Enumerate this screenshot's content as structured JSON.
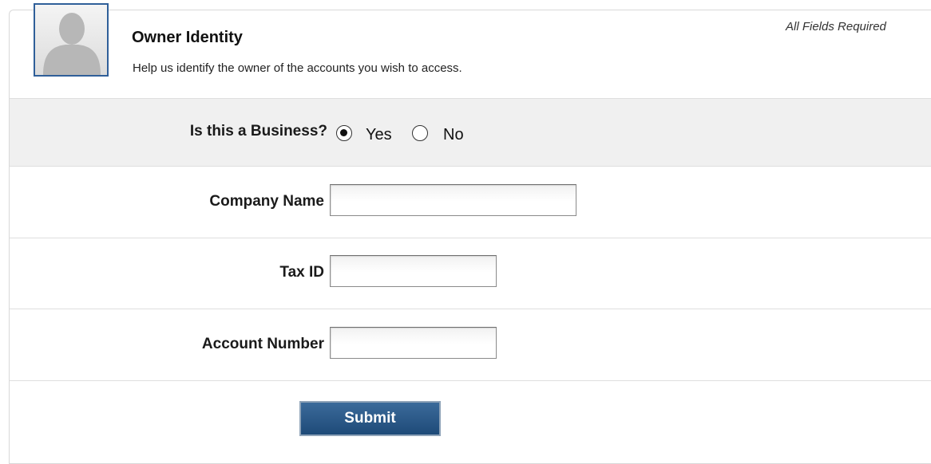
{
  "header": {
    "title": "Owner Identity",
    "subtitle": "Help us identify the owner of the accounts you wish to access.",
    "required_note": "All Fields Required",
    "avatar_icon": "person-silhouette-icon"
  },
  "form": {
    "business_question": {
      "label": "Is this a Business?",
      "options": [
        {
          "label": "Yes",
          "selected": true
        },
        {
          "label": "No",
          "selected": false
        }
      ]
    },
    "company_name": {
      "label": "Company Name",
      "value": ""
    },
    "tax_id": {
      "label": "Tax ID",
      "value": ""
    },
    "account_number": {
      "label": "Account Number",
      "value": ""
    },
    "submit_label": "Submit"
  },
  "colors": {
    "accent": "#2f5f99",
    "button": "#1e4a78",
    "shaded_row": "#f0f0f0",
    "divider": "#dedede"
  }
}
